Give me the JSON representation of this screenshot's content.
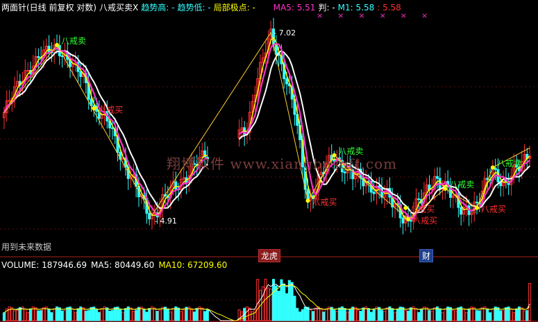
{
  "header": {
    "indicator_title": "两面针(日线 前复权 对数)",
    "formula_name": "八戒买卖X",
    "trend_high_label": "趋势高: -",
    "trend_low_label": "趋势低: -",
    "extreme_label": "局部极点: -",
    "ma5_label": "MA5: 5.51",
    "judge_label": "判: -",
    "m1_label": "M1: 5.58",
    "m2_label": ": 5.58",
    "close_marks": "×      ×      ×      ×      ×      ×"
  },
  "volume_header": {
    "volume_label": "VOLUME: 187946.69",
    "ma5_label": "MA5: 80449.60",
    "ma10_label": "MA10: 67209.60"
  },
  "notes": {
    "future_data": "用到未来数据",
    "watermark": "翔博软件 www.xiangbosoft.com",
    "tag_longhu": "龙虎",
    "tag_cai": "财"
  },
  "colors": {
    "up": "#ff3030",
    "down": "#33ffff",
    "ma_white": "#ffffff",
    "ma_yellow": "#ffff00",
    "ma_magenta": "#ff33cc",
    "ma_green": "#33cc33",
    "zigzag": "#ffcc33",
    "sell_label": "#33ff33",
    "buy_label": "#ff3030"
  },
  "chart_data": {
    "type": "candlestick",
    "title": "两面针(日线 前复权 对数)",
    "ylim": [
      4.6,
      7.3
    ],
    "price_extremes": {
      "high": 7.02,
      "low": 4.91
    },
    "signals": [
      {
        "label": "八戒卖",
        "idx": 20,
        "price": 6.85
      },
      {
        "label": "八戒买",
        "idx": 34,
        "price": 6.05
      },
      {
        "label": "八戒买",
        "idx": 115,
        "price": 5.05
      },
      {
        "label": "八戒卖",
        "idx": 125,
        "price": 5.52
      },
      {
        "label": "八戒买",
        "idx": 152,
        "price": 4.98
      },
      {
        "label": "八戒卖",
        "idx": 167,
        "price": 5.17
      },
      {
        "label": "八戒买",
        "idx": 179,
        "price": 4.98
      },
      {
        "label": "八戒卖",
        "idx": 185,
        "price": 5.39
      },
      {
        "label": "八戒买",
        "idx": 153,
        "price": 4.87
      }
    ],
    "key_points": [
      {
        "label": "7.02",
        "idx": 101,
        "price": 7.02
      },
      {
        "label": "4.91",
        "idx": 56,
        "price": 4.91
      }
    ],
    "volume": {
      "last": 187946.69,
      "ma5": 80449.6,
      "ma10": 67209.6
    }
  }
}
